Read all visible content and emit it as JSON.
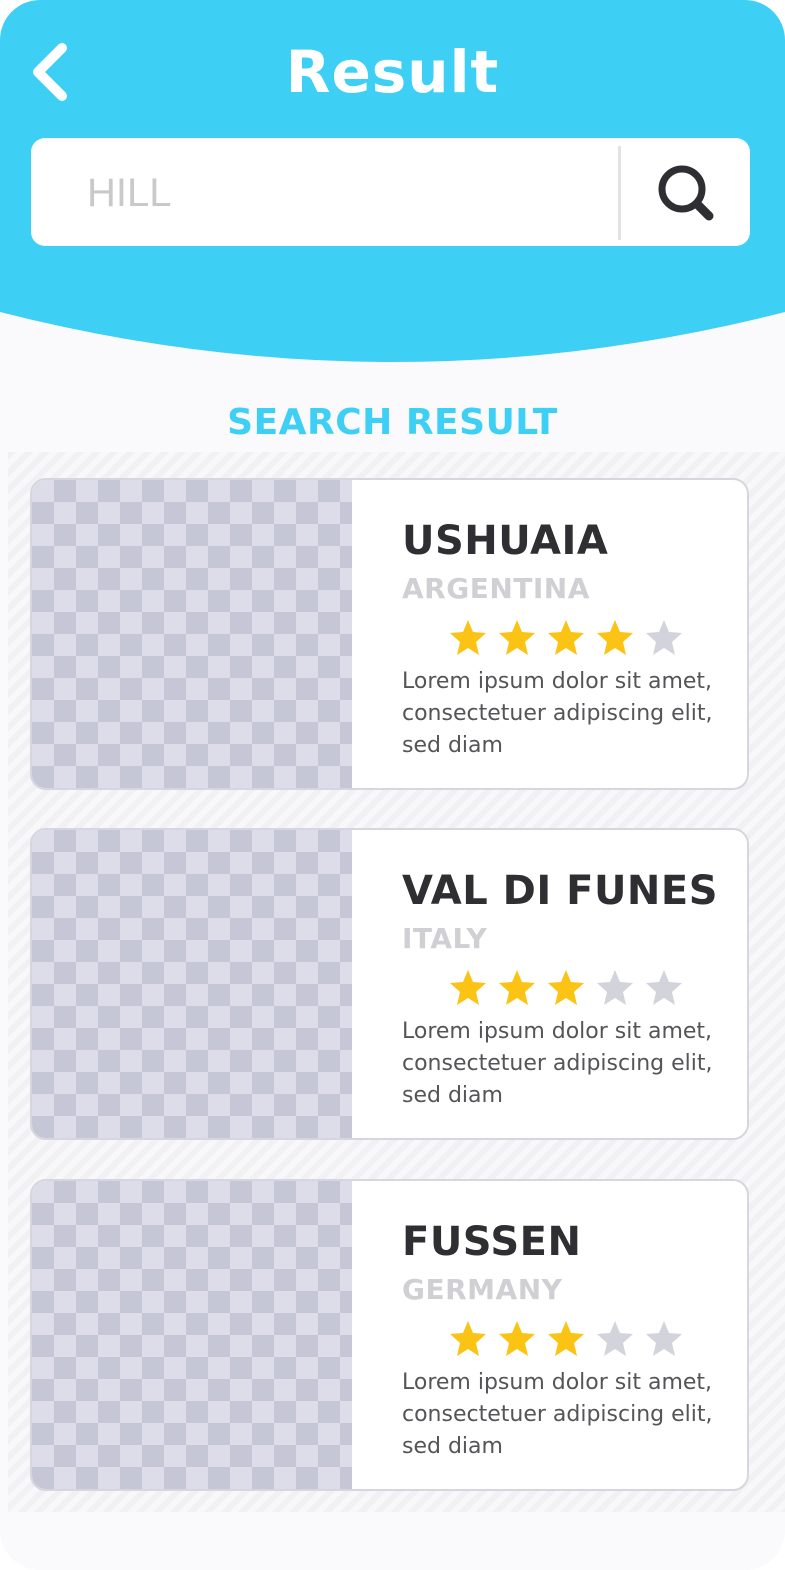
{
  "header": {
    "title": "Result"
  },
  "search": {
    "value": "HILL"
  },
  "section": {
    "title": "SEARCH RESULT"
  },
  "colors": {
    "accent": "#3ecff5",
    "star_filled": "#fbc313",
    "star_empty": "#d3d3dc"
  },
  "results": [
    {
      "name": "USHUAIA",
      "country": "ARGENTINA",
      "rating": 4,
      "max_rating": 5,
      "description": "Lorem ipsum dolor sit amet, consectetuer adipiscing elit, sed diam"
    },
    {
      "name": "VAL DI FUNES",
      "country": "ITALY",
      "rating": 3,
      "max_rating": 5,
      "description": "Lorem ipsum dolor sit amet, consectetuer adipiscing elit, sed diam"
    },
    {
      "name": "FUSSEN",
      "country": "GERMANY",
      "rating": 3,
      "max_rating": 5,
      "description": "Lorem ipsum dolor sit amet, consectetuer adipiscing elit, sed diam"
    }
  ]
}
